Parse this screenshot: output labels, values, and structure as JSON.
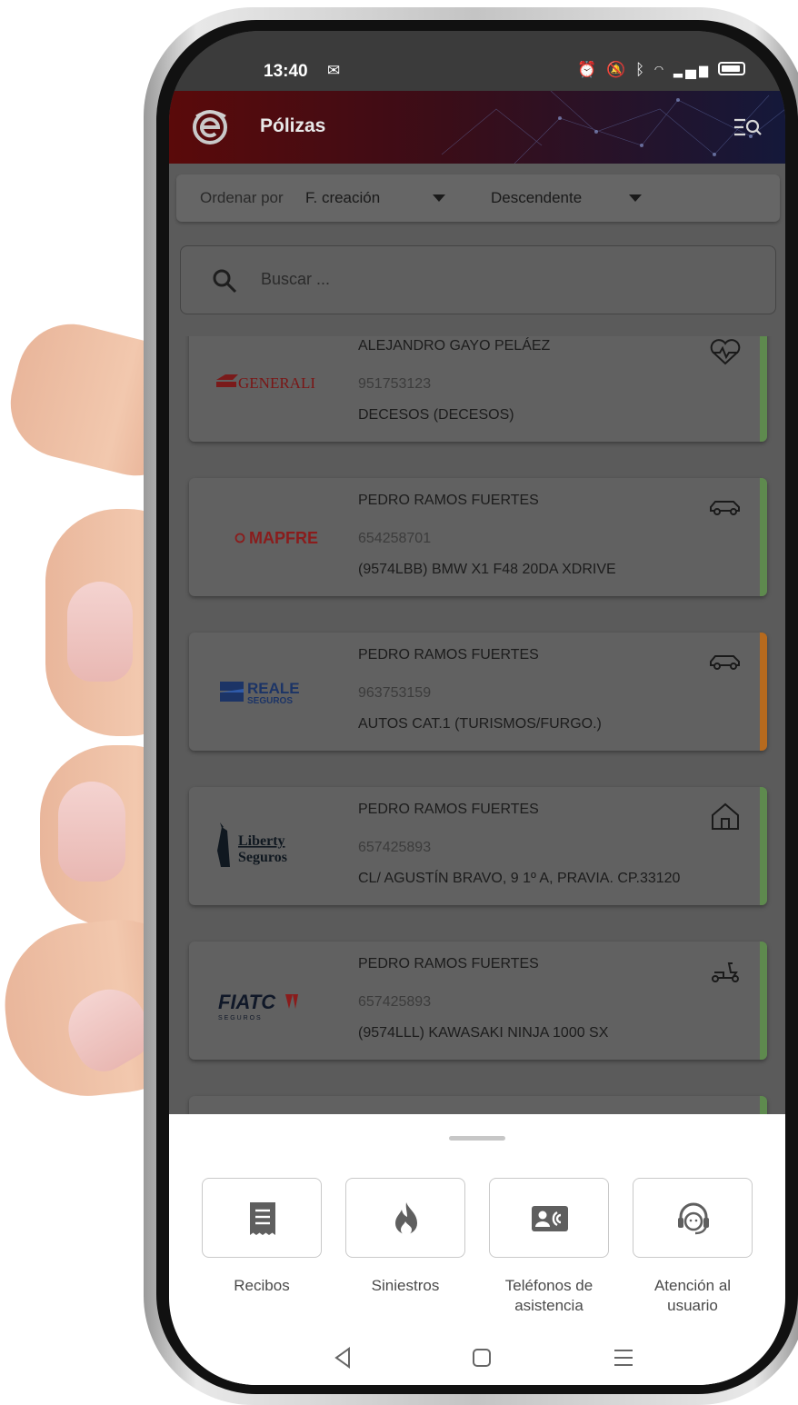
{
  "status_bar": {
    "time": "13:40"
  },
  "app_bar": {
    "title": "Pólizas"
  },
  "sort": {
    "label": "Ordenar por",
    "field": "F. creación",
    "order": "Descendente"
  },
  "search": {
    "placeholder": "Buscar ..."
  },
  "policies": [
    {
      "insurer": "GENERALI",
      "holder": "ALEJANDRO GAYO PELÁEZ",
      "number": "951753123",
      "description": "DECESOS (DECESOS)",
      "type_icon": "heart-pulse-icon",
      "stripe_color": "#5e8a4e"
    },
    {
      "insurer": "MAPFRE",
      "holder": "PEDRO RAMOS FUERTES",
      "number": "654258701",
      "description": "(9574LBB) BMW X1 F48 20DA XDRIVE",
      "type_icon": "car-icon",
      "stripe_color": "#5e8a4e"
    },
    {
      "insurer": "REALE",
      "insurer_sub": "SEGUROS",
      "holder": "PEDRO RAMOS FUERTES",
      "number": "963753159",
      "description": "AUTOS CAT.1 (TURISMOS/FURGO.)",
      "type_icon": "car-icon",
      "stripe_color": "#b66a1e"
    },
    {
      "insurer": "Liberty",
      "insurer_sub": "Seguros",
      "holder": "PEDRO RAMOS FUERTES",
      "number": "657425893",
      "description": "CL/ AGUSTÍN BRAVO, 9 1º A, PRAVIA. CP.33120",
      "type_icon": "home-icon",
      "stripe_color": "#5e8a4e"
    },
    {
      "insurer": "FIATC",
      "insurer_sub": "S E G U R O S",
      "holder": "PEDRO RAMOS FUERTES",
      "number": "657425893",
      "description": "(9574LLL) KAWASAKI NINJA 1000 SX",
      "type_icon": "scooter-icon",
      "stripe_color": "#5e8a4e"
    }
  ],
  "quick_actions": [
    {
      "label": "Recibos",
      "icon": "receipt-icon"
    },
    {
      "label": "Siniestros",
      "icon": "fire-icon"
    },
    {
      "label_line1": "Teléfonos de",
      "label_line2": "asistencia",
      "icon": "contact-card-icon"
    },
    {
      "label_line1": "Atención al",
      "label_line2": "usuario",
      "icon": "headset-icon"
    }
  ],
  "colors": {
    "accent_green": "#5e8a4e",
    "accent_orange": "#b66a1e",
    "mapfre_red": "#b01818",
    "generali_red": "#9c1b1b",
    "reale_blue": "#1d3f8a"
  }
}
